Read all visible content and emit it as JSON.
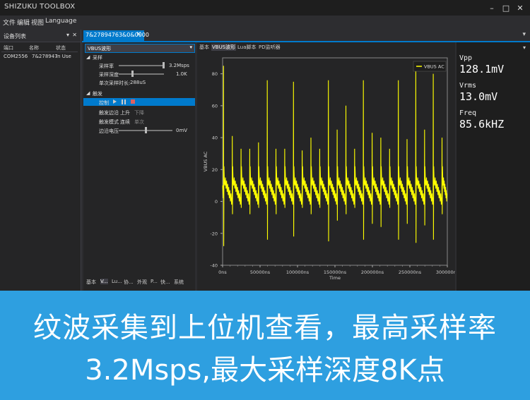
{
  "app": {
    "title": "SHIZUKU TOOLBOX"
  },
  "menu": [
    "文件",
    "编辑",
    "视图",
    "Language"
  ],
  "device_panel": {
    "title": "设备列表",
    "columns": [
      "端口",
      "名称",
      "状态"
    ],
    "rows": [
      {
        "port": "COM2556",
        "name": "7&278947",
        "status": "In Use"
      }
    ]
  },
  "document_tab": {
    "label": "7&27894763&0&0000"
  },
  "props": {
    "mode_select": "VBUS波形",
    "section_sampling": "采样",
    "sample_rate_label": "采样率",
    "sample_rate_value": "3.2Msps",
    "sample_depth_label": "采样深度",
    "sample_depth_value": "1.0K",
    "single_time_label": "单次采样时长:",
    "single_time_value": "288uS",
    "section_trigger": "触发",
    "control_label": "控制",
    "edge_label": "触发边沿",
    "edge_rise": "上升",
    "edge_fall": "下降",
    "mode_label": "触发模式",
    "mode_continuous": "连续",
    "mode_single": "单次",
    "edge_voltage_label": "边沿电压",
    "edge_voltage_value": "0mV",
    "bottom_tabs": [
      "基本",
      "V...",
      "Lu...",
      "协...",
      "外观",
      "P...",
      "快...",
      "系统"
    ]
  },
  "plot_tabs": [
    "基本",
    "VBUS波形",
    "Lua脚本",
    "PD监听器"
  ],
  "readouts": {
    "vpp_label": "Vpp",
    "vpp_value": "128.1mV",
    "vrms_label": "Vrms",
    "vrms_value": "13.0mV",
    "freq_label": "Freq",
    "freq_value": "85.6kHZ"
  },
  "chart_data": {
    "type": "line",
    "xlabel": "Time",
    "ylabel": "VBUS AC",
    "xlim": [
      0,
      300000
    ],
    "ylim": [
      -40,
      90
    ],
    "x_ticks": [
      "0ns",
      "50000ns",
      "100000ns",
      "150000ns",
      "200000ns",
      "250000ns",
      "300000ns"
    ],
    "y_ticks": [
      -40,
      -20,
      0,
      20,
      40,
      60,
      80
    ],
    "grid": false,
    "legend": "top-right",
    "period_ns": 11680,
    "spike_times_ns": [
      1000,
      12700,
      24400,
      36000,
      47700,
      59400,
      71000,
      82700,
      94400,
      106000,
      117700,
      129400,
      141000,
      152700,
      164400,
      176000,
      187700,
      199400,
      211000,
      222700,
      234400,
      246000,
      257700,
      269400,
      281000,
      292700
    ],
    "spike_peaks": [
      85,
      41,
      33,
      33,
      37,
      76,
      33,
      33,
      75,
      32,
      40,
      33,
      76,
      45,
      60,
      33,
      76,
      43,
      40,
      33,
      76,
      39,
      86,
      45,
      80,
      40
    ],
    "spike_troughs": [
      -28,
      -8,
      -4,
      -8,
      -4,
      -24,
      -8,
      -4,
      -22,
      -4,
      -8,
      -4,
      -25,
      -12,
      -8,
      -4,
      -24,
      -14,
      -16,
      -4,
      -24,
      -14,
      -26,
      -15,
      -24,
      -8
    ],
    "baseline": [
      10,
      0
    ],
    "series": [
      {
        "name": "VBUS AC",
        "color": "#ffff00"
      }
    ]
  },
  "banner": {
    "line1": "纹波采集到上位机查看，最高采样率",
    "line2": "3.2Msps,最大采样深度8K点"
  },
  "colors": {
    "accent": "#007acc",
    "trace": "#ffff00",
    "banner": "#2e9fe0"
  }
}
